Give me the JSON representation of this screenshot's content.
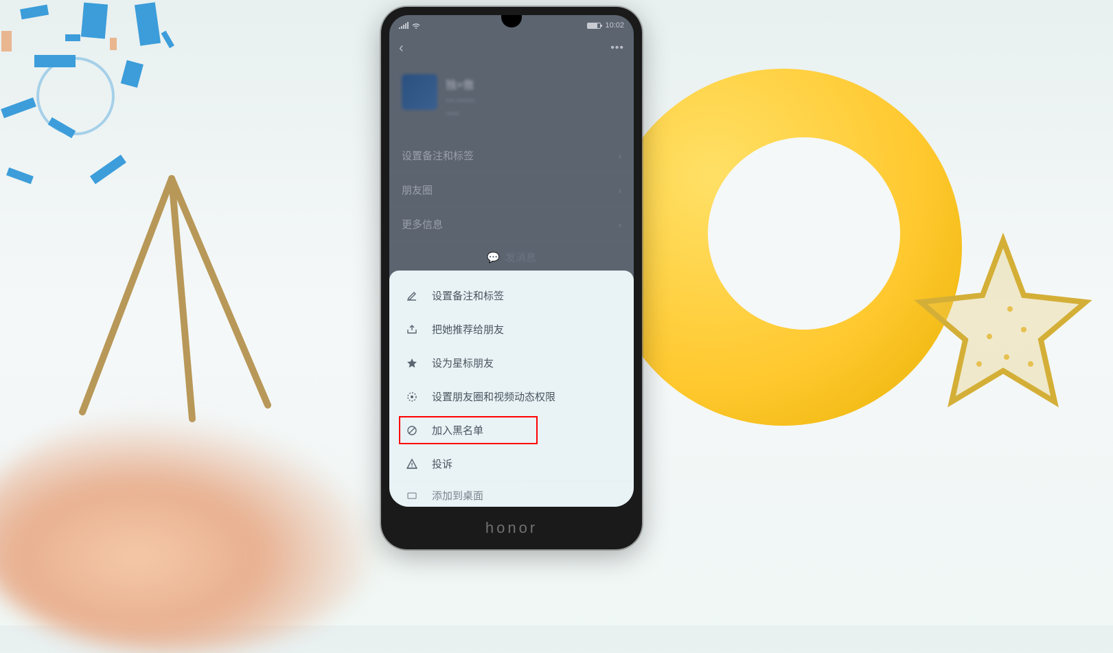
{
  "status_bar": {
    "time": "10:02"
  },
  "profile": {
    "nickname": "独×傲"
  },
  "settings": {
    "remarks_tags": "设置备注和标签",
    "moments": "朋友圈",
    "more_info": "更多信息",
    "send_message": "发消息"
  },
  "sheet": {
    "set_remarks": "设置备注和标签",
    "recommend": "把她推荐给朋友",
    "star_friend": "设为星标朋友",
    "privacy": "设置朋友圈和视频动态权限",
    "blacklist": "加入黑名单",
    "complain": "投诉",
    "add_desktop": "添加到桌面"
  },
  "phone_brand": "honor"
}
